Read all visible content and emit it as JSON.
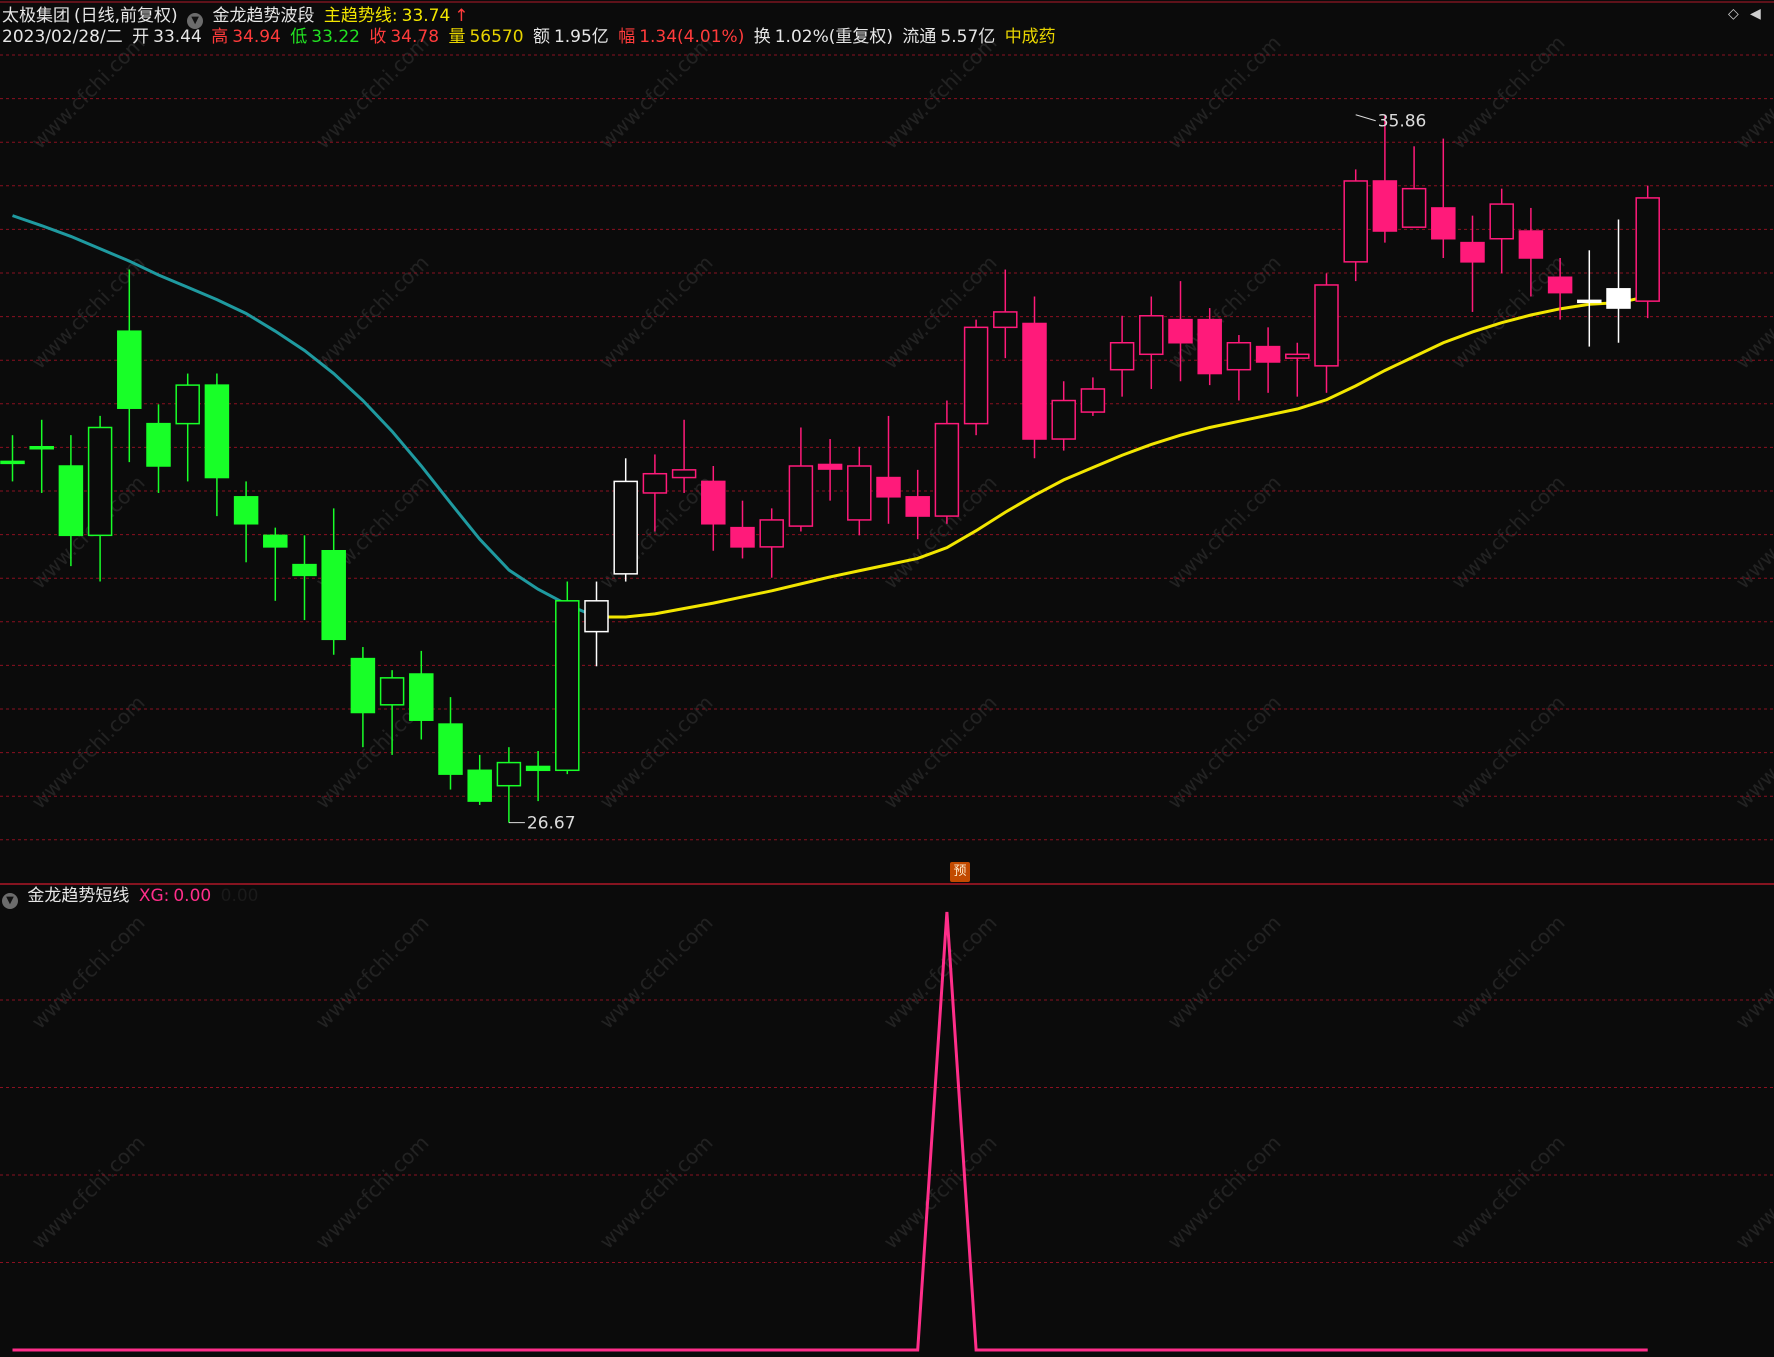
{
  "header": {
    "stock_name": "太极集团",
    "period": "(日线,前复权)",
    "indicator_name": "金龙趋势波段",
    "trend_label": "主趋势线:",
    "trend_value": "33.74",
    "trend_arrow": "↑",
    "date": "2023/02/28/二",
    "open_label": "开",
    "open_value": "33.44",
    "high_label": "高",
    "high_value": "34.94",
    "low_label": "低",
    "low_value": "33.22",
    "close_label": "收",
    "close_value": "34.78",
    "volume_label": "量",
    "volume_value": "56570",
    "amount_label": "额",
    "amount_value": "1.95亿",
    "change_label": "幅",
    "change_value": "1.34(4.01%)",
    "turnover_label": "换",
    "turnover_value": "1.02%(重复权)",
    "float_label": "流通",
    "float_value": "5.57亿",
    "sector": "中成药"
  },
  "sub_header": {
    "indicator_name": "金龙趋势短线",
    "xg_label": "XG:",
    "xg_value": "0.00",
    "extra_value": "0.00"
  },
  "badge": {
    "prediction": "预"
  },
  "watermark": "www.cfchi.com",
  "colors": {
    "background": "#0b0b0b",
    "grid": "#8a1020",
    "up": "#ff1a7a",
    "down": "#18ff28",
    "trend_down": "#1f9aa0",
    "trend_up": "#f2e600",
    "signal": "#ff2e8a"
  },
  "chart_data": [
    {
      "type": "candlestick",
      "title": "金龙趋势波段",
      "ylim": [
        25.9,
        36.7
      ],
      "grid": true,
      "annotations": [
        {
          "label": "35.86",
          "index": 46,
          "value": 35.86,
          "kind": "high"
        },
        {
          "label": "26.67",
          "index": 17,
          "value": 26.67,
          "kind": "low"
        }
      ],
      "candles": [
        {
          "o": 31.36,
          "h": 31.7,
          "l": 31.1,
          "c": 31.36,
          "color": "green"
        },
        {
          "o": 31.55,
          "h": 31.9,
          "l": 30.95,
          "c": 31.55,
          "color": "green"
        },
        {
          "o": 31.3,
          "h": 31.7,
          "l": 30.0,
          "c": 30.4,
          "color": "green"
        },
        {
          "o": 31.8,
          "h": 31.95,
          "l": 29.8,
          "c": 30.4,
          "color": "hollow-green"
        },
        {
          "o": 33.05,
          "h": 33.85,
          "l": 31.35,
          "c": 32.05,
          "color": "green"
        },
        {
          "o": 31.85,
          "h": 32.1,
          "l": 30.95,
          "c": 31.3,
          "color": "green"
        },
        {
          "o": 31.85,
          "h": 32.5,
          "l": 31.1,
          "c": 32.35,
          "color": "hollow-green"
        },
        {
          "o": 32.35,
          "h": 32.5,
          "l": 30.65,
          "c": 31.15,
          "color": "green"
        },
        {
          "o": 30.9,
          "h": 31.1,
          "l": 30.05,
          "c": 30.55,
          "color": "green"
        },
        {
          "o": 30.4,
          "h": 30.5,
          "l": 29.55,
          "c": 30.25,
          "color": "green"
        },
        {
          "o": 30.02,
          "h": 30.4,
          "l": 29.3,
          "c": 29.88,
          "color": "green"
        },
        {
          "o": 30.2,
          "h": 30.75,
          "l": 28.85,
          "c": 29.05,
          "color": "green"
        },
        {
          "o": 28.8,
          "h": 28.95,
          "l": 27.65,
          "c": 28.1,
          "color": "green"
        },
        {
          "o": 28.2,
          "h": 28.65,
          "l": 27.55,
          "c": 28.55,
          "color": "hollow-green"
        },
        {
          "o": 28.6,
          "h": 28.9,
          "l": 27.75,
          "c": 28.0,
          "color": "green"
        },
        {
          "o": 27.95,
          "h": 28.3,
          "l": 27.1,
          "c": 27.3,
          "color": "green"
        },
        {
          "o": 27.35,
          "h": 27.55,
          "l": 26.9,
          "c": 26.95,
          "color": "green"
        },
        {
          "o": 27.15,
          "h": 27.65,
          "l": 26.67,
          "c": 27.45,
          "color": "hollow-green"
        },
        {
          "o": 27.4,
          "h": 27.6,
          "l": 26.95,
          "c": 27.35,
          "color": "green"
        },
        {
          "o": 27.35,
          "h": 29.8,
          "l": 27.3,
          "c": 29.55,
          "color": "hollow-green"
        },
        {
          "o": 29.15,
          "h": 29.8,
          "l": 28.7,
          "c": 29.55,
          "color": "hollow-white"
        },
        {
          "o": 29.9,
          "h": 31.4,
          "l": 29.8,
          "c": 31.1,
          "color": "hollow-white"
        },
        {
          "o": 30.95,
          "h": 31.45,
          "l": 30.45,
          "c": 31.2,
          "color": "hollow-pink"
        },
        {
          "o": 31.15,
          "h": 31.9,
          "l": 30.95,
          "c": 31.25,
          "color": "hollow-pink"
        },
        {
          "o": 31.1,
          "h": 31.3,
          "l": 30.2,
          "c": 30.55,
          "color": "pink"
        },
        {
          "o": 30.5,
          "h": 30.85,
          "l": 30.1,
          "c": 30.25,
          "color": "pink"
        },
        {
          "o": 30.25,
          "h": 30.75,
          "l": 29.85,
          "c": 30.6,
          "color": "hollow-pink"
        },
        {
          "o": 30.52,
          "h": 31.8,
          "l": 30.45,
          "c": 31.3,
          "color": "hollow-pink"
        },
        {
          "o": 31.32,
          "h": 31.65,
          "l": 30.85,
          "c": 31.26,
          "color": "pink"
        },
        {
          "o": 30.6,
          "h": 31.55,
          "l": 30.4,
          "c": 31.3,
          "color": "hollow-pink"
        },
        {
          "o": 31.15,
          "h": 31.95,
          "l": 30.55,
          "c": 30.9,
          "color": "pink"
        },
        {
          "o": 30.9,
          "h": 31.25,
          "l": 30.35,
          "c": 30.65,
          "color": "pink"
        },
        {
          "o": 30.65,
          "h": 32.15,
          "l": 30.55,
          "c": 31.85,
          "color": "hollow-pink"
        },
        {
          "o": 31.85,
          "h": 33.2,
          "l": 31.7,
          "c": 33.1,
          "color": "hollow-pink"
        },
        {
          "o": 33.1,
          "h": 33.85,
          "l": 32.7,
          "c": 33.3,
          "color": "hollow-pink"
        },
        {
          "o": 33.15,
          "h": 33.5,
          "l": 31.4,
          "c": 31.65,
          "color": "pink"
        },
        {
          "o": 31.65,
          "h": 32.4,
          "l": 31.5,
          "c": 32.15,
          "color": "hollow-pink"
        },
        {
          "o": 32.0,
          "h": 32.45,
          "l": 31.95,
          "c": 32.3,
          "color": "hollow-pink"
        },
        {
          "o": 32.55,
          "h": 33.25,
          "l": 32.2,
          "c": 32.9,
          "color": "hollow-pink"
        },
        {
          "o": 32.75,
          "h": 33.5,
          "l": 32.3,
          "c": 33.25,
          "color": "hollow-pink"
        },
        {
          "o": 33.2,
          "h": 33.7,
          "l": 32.4,
          "c": 32.9,
          "color": "pink"
        },
        {
          "o": 33.2,
          "h": 33.35,
          "l": 32.35,
          "c": 32.5,
          "color": "pink"
        },
        {
          "o": 32.55,
          "h": 33.0,
          "l": 32.15,
          "c": 32.9,
          "color": "hollow-pink"
        },
        {
          "o": 32.85,
          "h": 33.1,
          "l": 32.25,
          "c": 32.65,
          "color": "pink"
        },
        {
          "o": 32.75,
          "h": 32.9,
          "l": 32.2,
          "c": 32.7,
          "color": "hollow-pink"
        },
        {
          "o": 32.6,
          "h": 33.8,
          "l": 32.25,
          "c": 33.65,
          "color": "hollow-pink"
        },
        {
          "o": 33.95,
          "h": 35.15,
          "l": 33.7,
          "c": 35.0,
          "color": "hollow-pink"
        },
        {
          "o": 35.0,
          "h": 35.86,
          "l": 34.2,
          "c": 34.35,
          "color": "pink"
        },
        {
          "o": 34.9,
          "h": 35.45,
          "l": 34.4,
          "c": 34.4,
          "color": "hollow-pink"
        },
        {
          "o": 34.65,
          "h": 35.55,
          "l": 34.0,
          "c": 34.25,
          "color": "pink"
        },
        {
          "o": 34.2,
          "h": 34.55,
          "l": 33.3,
          "c": 33.95,
          "color": "pink"
        },
        {
          "o": 34.25,
          "h": 34.9,
          "l": 33.8,
          "c": 34.7,
          "color": "hollow-pink"
        },
        {
          "o": 34.35,
          "h": 34.65,
          "l": 33.5,
          "c": 34.0,
          "color": "pink"
        },
        {
          "o": 33.75,
          "h": 34.0,
          "l": 33.2,
          "c": 33.55,
          "color": "pink"
        },
        {
          "o": 33.45,
          "h": 34.1,
          "l": 32.85,
          "c": 33.45,
          "color": "white"
        },
        {
          "o": 33.6,
          "h": 34.5,
          "l": 32.9,
          "c": 33.35,
          "color": "white"
        },
        {
          "o": 33.44,
          "h": 34.94,
          "l": 33.22,
          "c": 34.78,
          "color": "hollow-pink"
        }
      ],
      "trend_line": {
        "name": "主趋势线",
        "down_values": [
          34.55,
          34.42,
          34.28,
          34.12,
          33.96,
          33.78,
          33.62,
          33.46,
          33.28,
          33.05,
          32.8,
          32.5,
          32.15,
          31.75,
          31.3,
          30.82,
          30.35,
          29.95,
          29.7,
          29.5,
          29.34
        ],
        "up_values": [
          null,
          null,
          null,
          null,
          null,
          null,
          null,
          null,
          null,
          null,
          null,
          null,
          null,
          null,
          null,
          null,
          null,
          null,
          null,
          null,
          29.34,
          29.34,
          29.38,
          29.45,
          29.52,
          29.6,
          29.68,
          29.77,
          29.86,
          29.94,
          30.02,
          30.1,
          30.24,
          30.46,
          30.7,
          30.92,
          31.12,
          31.28,
          31.44,
          31.58,
          31.7,
          31.8,
          31.88,
          31.96,
          32.04,
          32.16,
          32.34,
          32.54,
          32.72,
          32.9,
          33.04,
          33.16,
          33.26,
          33.34,
          33.4,
          33.42,
          33.5
        ]
      }
    },
    {
      "type": "line",
      "title": "金龙趋势短线",
      "ylim": [
        0,
        1
      ],
      "grid": true,
      "series": [
        {
          "name": "XG",
          "values": [
            0,
            0,
            0,
            0,
            0,
            0,
            0,
            0,
            0,
            0,
            0,
            0,
            0,
            0,
            0,
            0,
            0,
            0,
            0,
            0,
            0,
            0,
            0,
            0,
            0,
            0,
            0,
            0,
            0,
            0,
            0,
            0,
            1,
            0,
            0,
            0,
            0,
            0,
            0,
            0,
            0,
            0,
            0,
            0,
            0,
            0,
            0,
            0,
            0,
            0,
            0,
            0,
            0,
            0,
            0,
            0,
            0
          ]
        }
      ]
    }
  ]
}
